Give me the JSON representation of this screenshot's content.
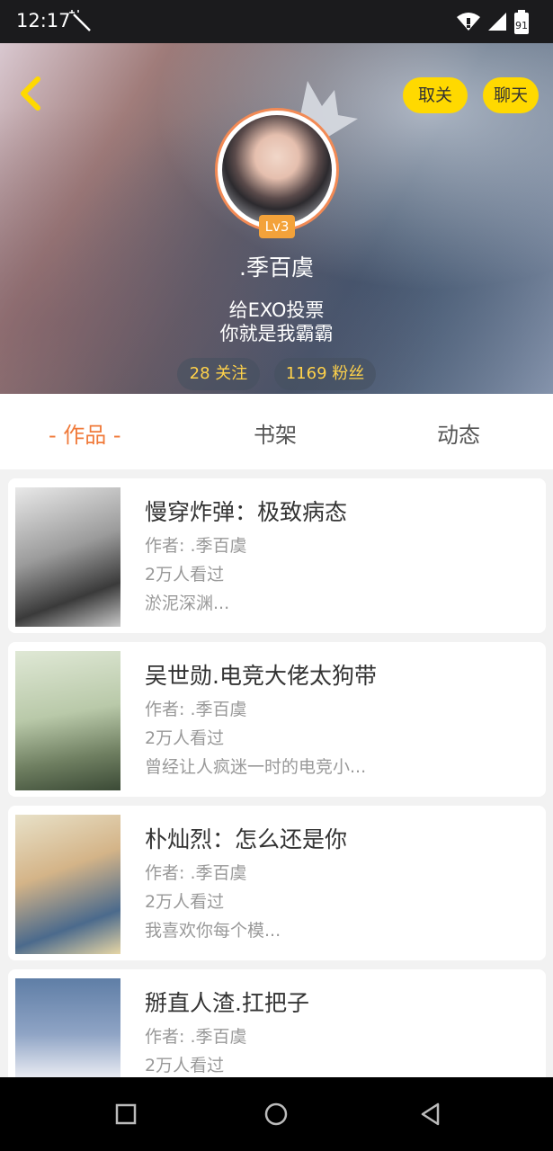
{
  "status_bar": {
    "time": "12:17",
    "battery": "91"
  },
  "header": {
    "unfollow_label": "取关",
    "chat_label": "聊天",
    "level": "Lv3",
    "username": ".季百虞",
    "bio_line1": "给EXO投票",
    "bio_line2": "你就是我霸霸",
    "following": "28 关注",
    "followers": "1169 粉丝"
  },
  "tabs": [
    "- 作品 -",
    "书架",
    "动态"
  ],
  "books": [
    {
      "title": "慢穿炸弹：极致病态",
      "author": "作者: .季百虞",
      "views": "2万人看过",
      "summary": "淤泥深渊..."
    },
    {
      "title": "吴世勋.电竞大佬太狗带",
      "author": "作者: .季百虞",
      "views": "2万人看过",
      "summary": "曾经让人疯迷一时的电竞小..."
    },
    {
      "title": "朴灿烈：怎么还是你",
      "author": "作者: .季百虞",
      "views": "2万人看过",
      "summary": "我喜欢你每个模..."
    },
    {
      "title": "掰直人渣.扛把子",
      "author": "作者: .季百虞",
      "views": "2万人看过",
      "summary": ""
    }
  ],
  "colors": {
    "accent": "#f07a3a",
    "pill": "#ffd900",
    "level_badge": "#f3a23a",
    "stat_text": "#ffd24a"
  }
}
